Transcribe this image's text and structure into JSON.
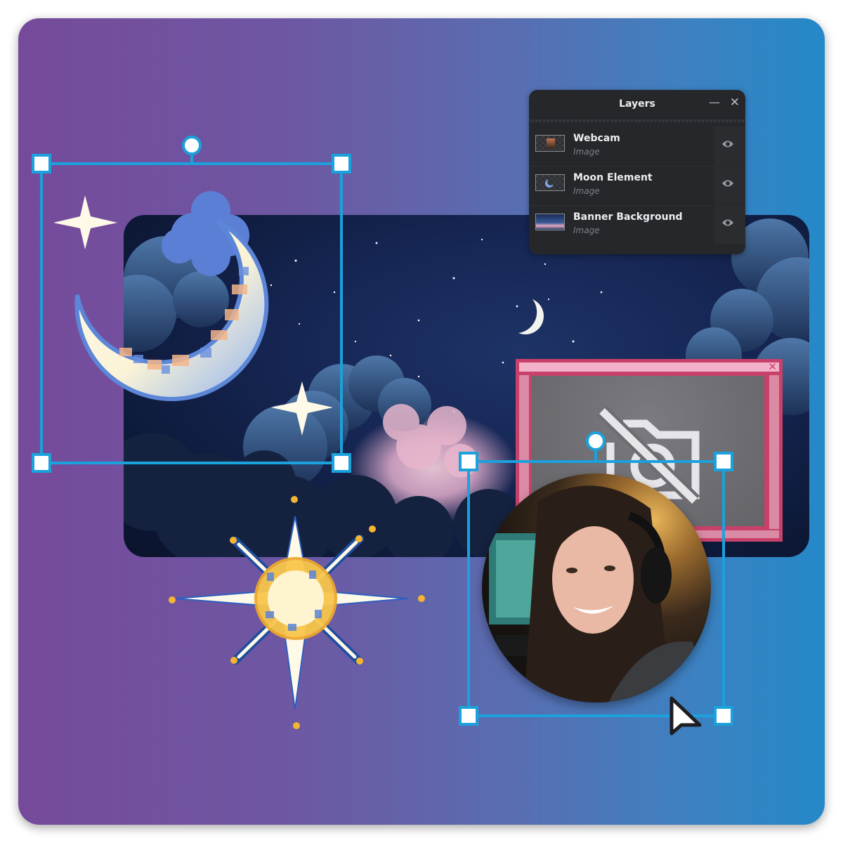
{
  "layers_panel": {
    "title": "Layers",
    "minimize_icon": "minimize-icon",
    "close_icon": "close-icon",
    "layers": [
      {
        "name": "Webcam",
        "type": "Image",
        "visible": true,
        "visibility_icon": "eye-icon"
      },
      {
        "name": "Moon Element",
        "type": "Image",
        "visible": true,
        "visibility_icon": "eye-icon"
      },
      {
        "name": "Banner Background",
        "type": "Image",
        "visible": true,
        "visibility_icon": "eye-icon"
      }
    ]
  },
  "canvas": {
    "elements": [
      {
        "name": "Moon Element",
        "selected": true
      },
      {
        "name": "Webcam",
        "selected": true
      },
      {
        "name": "Banner Background",
        "selected": false
      },
      {
        "name": "Star Element",
        "selected": false
      }
    ],
    "webcam_placeholder": {
      "close_glyph": "✕",
      "icon": "camera-off-icon"
    }
  },
  "colors": {
    "background_start": "#764A9B",
    "background_end": "#2489C8",
    "selection": "#1BA1DB",
    "panel_bg": "#25272B",
    "webcam_frame": "#C8416A",
    "webcam_titlebar": "#F2B2C9"
  }
}
